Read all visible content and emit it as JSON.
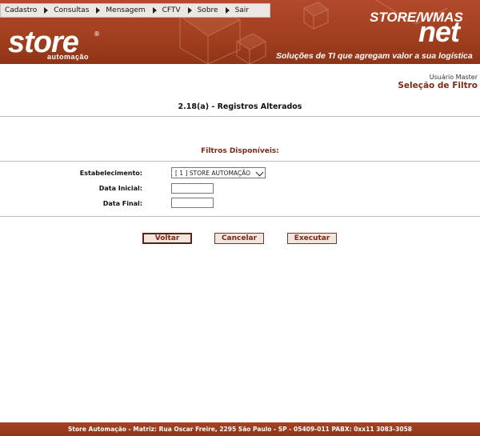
{
  "menu": {
    "items": [
      {
        "label": "Cadastro"
      },
      {
        "label": "Consultas"
      },
      {
        "label": "Mensagem"
      },
      {
        "label": "CFTV"
      },
      {
        "label": "Sobre"
      },
      {
        "label": "Sair"
      }
    ]
  },
  "logo": {
    "name": "store",
    "registered": "®",
    "sub": "automação"
  },
  "brand": {
    "top": "STORE/WMAS",
    "net": "net",
    "tagline": "Soluções de TI que agregam valor a sua logística"
  },
  "header": {
    "user": "Usuário Master",
    "page_heading": "Seleção de Filtro"
  },
  "report": {
    "title": "2.18(a) - Registros Alterados"
  },
  "filters": {
    "section_title": "Filtros Disponíveis:",
    "establishment_label": "Estabelecimento:",
    "establishment_value": "[ 1 ] STORE AUTOMAÇÃO",
    "start_date_label": "Data Inicial:",
    "start_date_value": "",
    "end_date_label": "Data Final:",
    "end_date_value": ""
  },
  "buttons": {
    "back": "Voltar",
    "cancel": "Cancelar",
    "run": "Executar"
  },
  "footer": {
    "text": "Store Automação - Matriz: Rua Oscar Freire, 2295 São Paulo - SP - 05409-011 PABX: 0xx11 3083-3058"
  },
  "colors": {
    "brand": "#a2401f",
    "accent_text": "#7a2a18",
    "button_bg": "#efe6df"
  }
}
